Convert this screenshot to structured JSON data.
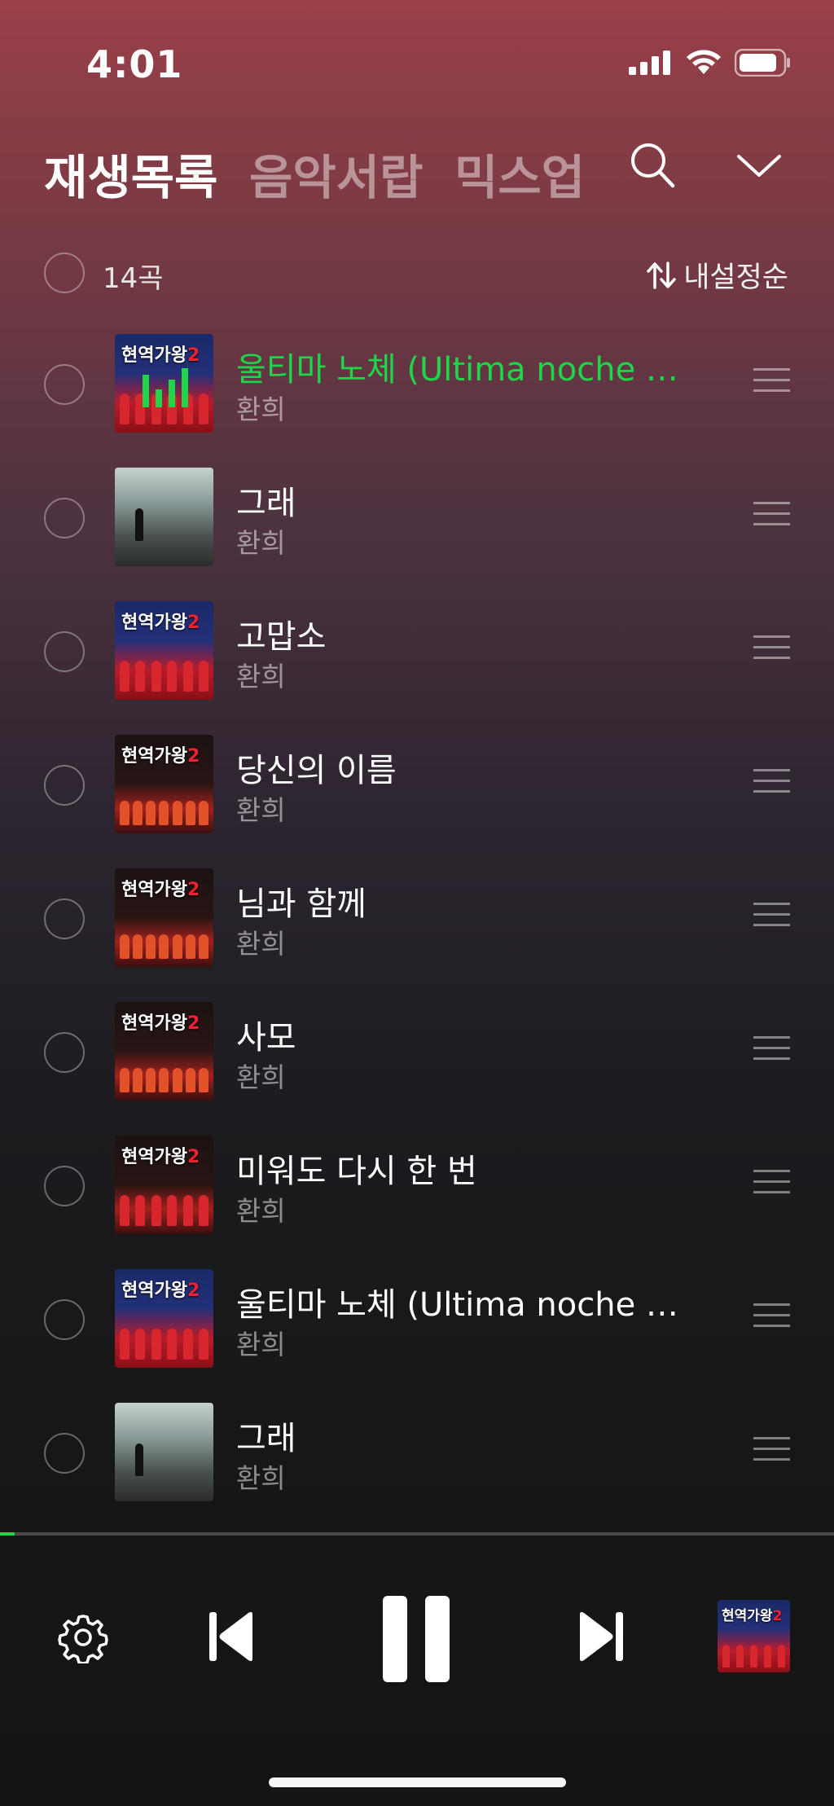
{
  "status": {
    "time": "4:01"
  },
  "header": {
    "tabs": [
      {
        "label": "재생목록",
        "active": true
      },
      {
        "label": "음악서랍",
        "active": false
      },
      {
        "label": "믹스업",
        "active": false
      }
    ],
    "search_icon": "search-icon",
    "collapse_icon": "chevron-down-icon"
  },
  "subheader": {
    "count": "14곡",
    "sort_label": "내설정순"
  },
  "tracks": [
    {
      "title": "울티마 노체 (Ultima noche 마…",
      "artist": "환희",
      "playing": true
    },
    {
      "title": "그래",
      "artist": "환희",
      "playing": false
    },
    {
      "title": "고맙소",
      "artist": "환희",
      "playing": false
    },
    {
      "title": "당신의 이름",
      "artist": "환희",
      "playing": false
    },
    {
      "title": "님과 함께",
      "artist": "환희",
      "playing": false
    },
    {
      "title": "사모",
      "artist": "환희",
      "playing": false
    },
    {
      "title": "미워도 다시 한 번",
      "artist": "환희",
      "playing": false
    },
    {
      "title": "울티마 노체 (Ultima noche 마…",
      "artist": "환희",
      "playing": false
    },
    {
      "title": "그래",
      "artist": "환희",
      "playing": false
    }
  ],
  "album_art_text": {
    "line": "현역가왕",
    "number": "2"
  },
  "playback": {
    "progress_fraction": 0.018
  },
  "colors": {
    "accent": "#1ed64a",
    "background_top": "#9a4048",
    "background_bottom": "#141414"
  }
}
